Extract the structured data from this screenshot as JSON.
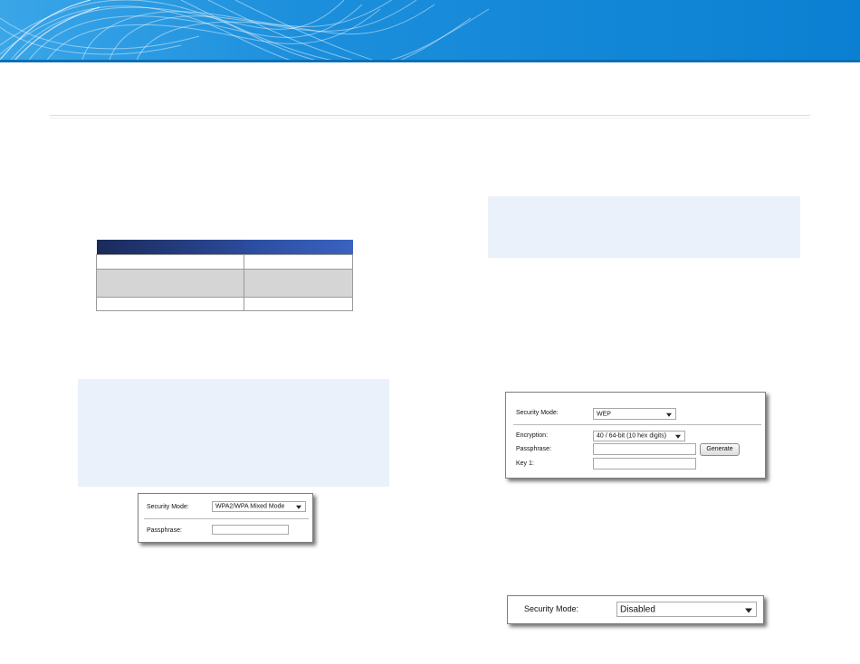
{
  "colors": {
    "banner": "#0d83d4",
    "banner_light": "#3aa6e8",
    "note_bg": "#eaf1fb",
    "table_header": "#1a2a5a",
    "table_shaded_row": "#d5d5d5"
  },
  "security_table": {
    "headers": [
      "",
      ""
    ],
    "rows": [
      [
        "",
        ""
      ],
      [
        "",
        ""
      ],
      [
        "",
        ""
      ]
    ]
  },
  "wpa_panel": {
    "security_mode_label": "Security Mode:",
    "security_mode_value": "WPA2/WPA Mixed Mode",
    "passphrase_label": "Passphrase:",
    "passphrase_value": ""
  },
  "wep_panel": {
    "security_mode_label": "Security Mode:",
    "security_mode_value": "WEP",
    "encryption_label": "Encryption:",
    "encryption_value": "40 / 64-bit (10 hex digits)",
    "passphrase_label": "Passphrase:",
    "passphrase_value": "",
    "generate_button": "Generate",
    "key1_label": "Key 1:",
    "key1_value": ""
  },
  "disabled_panel": {
    "security_mode_label": "Security Mode:",
    "security_mode_value": "Disabled"
  }
}
